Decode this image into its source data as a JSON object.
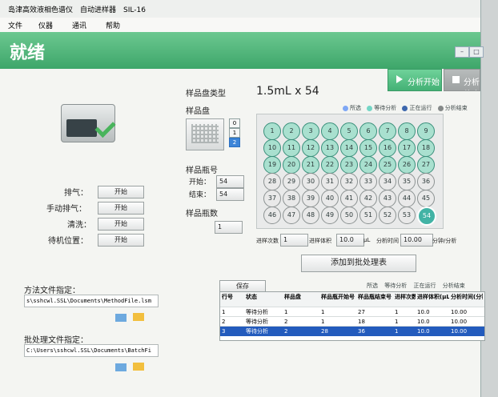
{
  "app": {
    "title": "岛津高效液相色谱仪　自动进样器　SIL-16",
    "menu": [
      "文件",
      "仪器",
      "通讯",
      "帮助"
    ],
    "status": "就绪",
    "window_controls": [
      "–",
      "□"
    ]
  },
  "run_controls": {
    "start": "分析开始",
    "stop": "分析停止"
  },
  "left_panel": {
    "functions": [
      {
        "label": "排气：",
        "button": "开始"
      },
      {
        "label": "手动排气：",
        "button": "开始"
      },
      {
        "label": "清洗：",
        "button": "开始"
      },
      {
        "label": "待机位置：",
        "button": "开始"
      }
    ],
    "method_file_label": "方法文件指定：",
    "method_file_path": "s\\sshcwl.SSL\\Documents\\MethodFile.lsm",
    "batch_file_label": "批处理文件指定：",
    "batch_file_path": "C:\\Users\\sshcwl.SSL\\Documents\\BatchFi"
  },
  "sample_settings": {
    "tray_type_label": "样品盘类型",
    "tray_type_value": "1.5mL x 54",
    "tray_label": "样品盘",
    "tray_indices": [
      "0",
      "1",
      "2"
    ],
    "vial_no_label": "样品瓶号",
    "start_label": "开始：",
    "start_value": "54",
    "end_label": "结束：",
    "end_value": "54",
    "vial_count_label": "样品瓶数",
    "vial_count_value": "1"
  },
  "plate": {
    "legend": [
      {
        "text": "所选",
        "color": "#7ea7f5"
      },
      {
        "text": "等待分析",
        "color": "#74d6c6"
      },
      {
        "text": "正在运行",
        "color": "#3d67ad"
      },
      {
        "text": "分析结束",
        "color": "#858989"
      }
    ],
    "rows": [
      [
        "1",
        "2",
        "3",
        "4",
        "5",
        "6",
        "7",
        "8",
        "9"
      ],
      [
        "10",
        "11",
        "12",
        "13",
        "14",
        "15",
        "16",
        "17",
        "18"
      ],
      [
        "19",
        "20",
        "21",
        "22",
        "23",
        "24",
        "25",
        "26",
        "27"
      ],
      [
        "28",
        "29",
        "30",
        "31",
        "32",
        "33",
        "34",
        "35",
        "36"
      ],
      [
        "37",
        "38",
        "39",
        "40",
        "41",
        "42",
        "43",
        "44",
        "45"
      ],
      [
        "46",
        "47",
        "48",
        "49",
        "50",
        "51",
        "52",
        "53",
        "54"
      ]
    ],
    "controls": {
      "injection_count_label": "进样次数",
      "injection_count": "1",
      "injection_volume_label": "进样体积",
      "injection_volume": "10.0",
      "injection_volume_unit": "μL",
      "analysis_time_label": "分析时间",
      "analysis_time": "10.00",
      "analysis_time_unit": "分钟/分析"
    },
    "add_button": "添加到批处理表"
  },
  "batch_table": {
    "save_button": "保存",
    "legend": [
      {
        "text": "所选"
      },
      {
        "text": "等待分析"
      },
      {
        "text": "正在运行"
      },
      {
        "text": "分析结束"
      }
    ],
    "columns": [
      "行号",
      "状态",
      "样品盘",
      "样品瓶开始号",
      "样品瓶结束号",
      "进样次数",
      "进样体积(μL)",
      "分析时间(分钟/分析)"
    ],
    "rows": [
      [
        "1",
        "等待分析",
        "1",
        "1",
        "27",
        "1",
        "10.0",
        "10.00"
      ],
      [
        "2",
        "等待分析",
        "2",
        "1",
        "18",
        "1",
        "10.0",
        "10.00"
      ],
      [
        "3",
        "等待分析",
        "2",
        "28",
        "36",
        "1",
        "10.0",
        "10.00"
      ]
    ]
  }
}
